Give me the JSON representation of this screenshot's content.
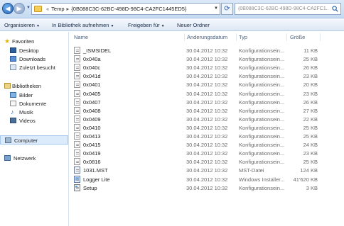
{
  "address_bar": {
    "crumbs": [
      "Temp",
      "{0B088C3C-62BC-498D-98C4-CA2FC1445ED5}"
    ],
    "search_placeholder": "{0B088C3C-62BC-498D-98C4-CA2FC1..."
  },
  "toolbar": {
    "organize": "Organisieren",
    "library": "In Bibliothek aufnehmen",
    "share": "Freigeben für",
    "new_folder": "Neuer Ordner"
  },
  "sidebar": {
    "favorites": {
      "title": "Favoriten",
      "items": [
        "Desktop",
        "Downloads",
        "Zuletzt besucht"
      ]
    },
    "libraries": {
      "title": "Bibliotheken",
      "items": [
        "Bilder",
        "Dokumente",
        "Musik",
        "Videos"
      ]
    },
    "computer": "Computer",
    "network": "Netzwerk"
  },
  "columns": {
    "name": "Name",
    "date": "Änderungsdatum",
    "type": "Typ",
    "size": "Größe"
  },
  "files": [
    {
      "name": "_ISMSIDEL",
      "date": "30.04.2012 10:32",
      "type": "Konfigurationsein...",
      "size": "11 KB",
      "icon": "config-file-icon"
    },
    {
      "name": "0x040a",
      "date": "30.04.2012 10:32",
      "type": "Konfigurationsein...",
      "size": "25 KB",
      "icon": "config-file-icon"
    },
    {
      "name": "0x040c",
      "date": "30.04.2012 10:32",
      "type": "Konfigurationsein...",
      "size": "26 KB",
      "icon": "config-file-icon"
    },
    {
      "name": "0x041d",
      "date": "30.04.2012 10:32",
      "type": "Konfigurationsein...",
      "size": "23 KB",
      "icon": "config-file-icon"
    },
    {
      "name": "0x0401",
      "date": "30.04.2012 10:32",
      "type": "Konfigurationsein...",
      "size": "20 KB",
      "icon": "config-file-icon"
    },
    {
      "name": "0x0405",
      "date": "30.04.2012 10:32",
      "type": "Konfigurationsein...",
      "size": "23 KB",
      "icon": "config-file-icon"
    },
    {
      "name": "0x0407",
      "date": "30.04.2012 10:32",
      "type": "Konfigurationsein...",
      "size": "26 KB",
      "icon": "config-file-icon"
    },
    {
      "name": "0x0408",
      "date": "30.04.2012 10:32",
      "type": "Konfigurationsein...",
      "size": "27 KB",
      "icon": "config-file-icon"
    },
    {
      "name": "0x0409",
      "date": "30.04.2012 10:32",
      "type": "Konfigurationsein...",
      "size": "22 KB",
      "icon": "config-file-icon"
    },
    {
      "name": "0x0410",
      "date": "30.04.2012 10:32",
      "type": "Konfigurationsein...",
      "size": "25 KB",
      "icon": "config-file-icon"
    },
    {
      "name": "0x0413",
      "date": "30.04.2012 10:32",
      "type": "Konfigurationsein...",
      "size": "25 KB",
      "icon": "config-file-icon"
    },
    {
      "name": "0x0415",
      "date": "30.04.2012 10:32",
      "type": "Konfigurationsein...",
      "size": "24 KB",
      "icon": "config-file-icon"
    },
    {
      "name": "0x0419",
      "date": "30.04.2012 10:32",
      "type": "Konfigurationsein...",
      "size": "23 KB",
      "icon": "config-file-icon"
    },
    {
      "name": "0x0816",
      "date": "30.04.2012 10:32",
      "type": "Konfigurationsein...",
      "size": "25 KB",
      "icon": "config-file-icon"
    },
    {
      "name": "1031.MST",
      "date": "30.04.2012 10:32",
      "type": "MST-Datei",
      "size": "124 KB",
      "icon": "mst-file-icon"
    },
    {
      "name": "Logger Lite",
      "date": "30.04.2012 10:32",
      "type": "Windows Installer...",
      "size": "41'620 KB",
      "icon": "installer-file-icon"
    },
    {
      "name": "Setup",
      "date": "30.04.2012 10:32",
      "type": "Konfigurationsein...",
      "size": "3 KB",
      "icon": "config-file-icon"
    }
  ]
}
